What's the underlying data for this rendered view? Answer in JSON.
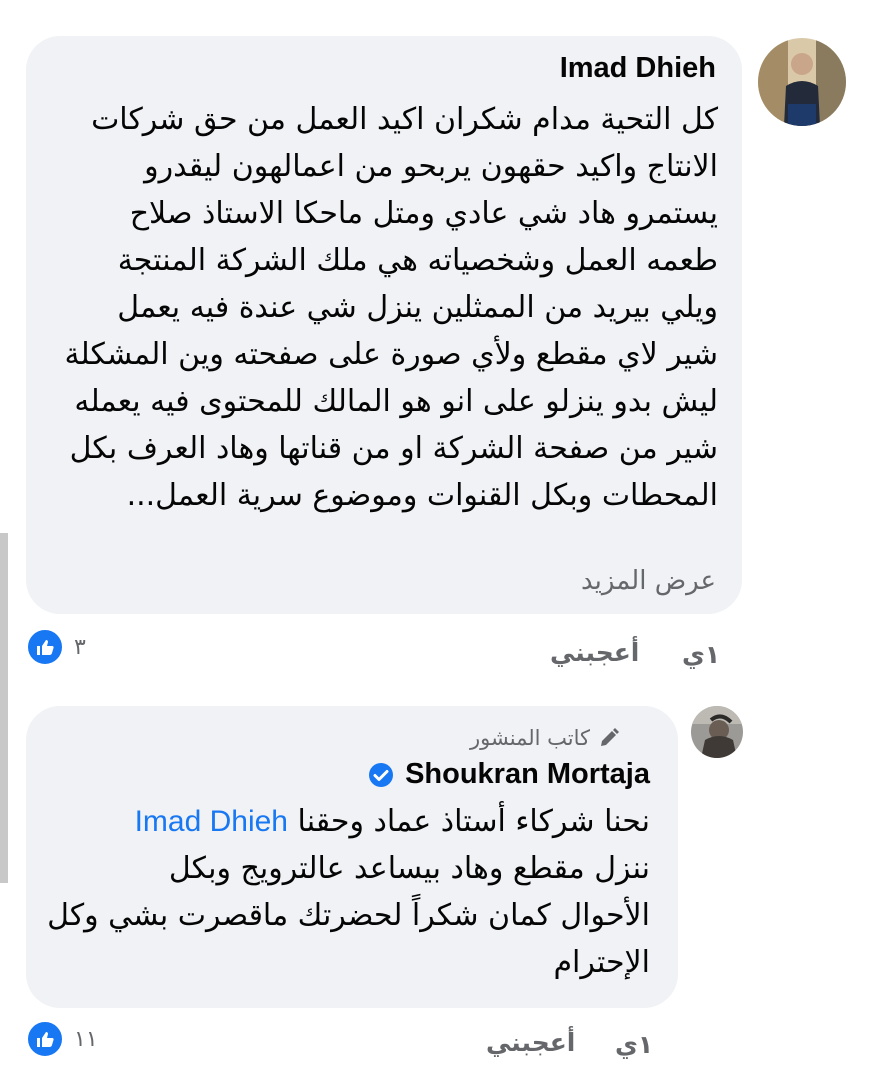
{
  "comments": [
    {
      "author": "Imad Dhieh",
      "lines": [
        "كل التحية مدام شكران اكيد العمل من حق شركات",
        "الانتاج واكيد حقهون يربحو من اعمالهون ليقدرو",
        "يستمرو هاد شي عادي ومتل ماحكا الاستاذ صلاح",
        "طعمه العمل وشخصياته هي ملك الشركة المنتجة",
        "ويلي بيريد من الممثلين ينزل شي عندة فيه يعمل",
        "شير لاي مقطع ولأي صورة على صفحته وين المشكلة",
        "ليش بدو ينزلو على انو هو المالك للمحتوى فيه يعمله",
        "شير من صفحة الشركة او من قناتها وهاد العرف بكل",
        "المحطات وبكل القنوات وموضوع سرية العمل..."
      ],
      "see_more": "عرض المزيد",
      "time": "١ي",
      "like_label": "أعجبني",
      "reaction_count": "٣",
      "avatar_icon": "person-photo-icon"
    },
    {
      "author_badge": "كاتب المنشور",
      "author": "Shoukran Mortaja",
      "verified_icon": "verified-badge-icon",
      "mention": "Imad Dhieh",
      "first_line_text": "نحنا شركاء أستاذ عماد وحقنا",
      "lines": [
        "ننزل مقطع وهاد بيساعد عالترويج وبكل",
        "الأحوال كمان شكراً لحضرتك ماقصرت بشي وكل",
        "الإحترام"
      ],
      "time": "١ي",
      "like_label": "أعجبني",
      "reaction_count": "١١",
      "avatar_icon": "person-photo-icon"
    }
  ],
  "colors": {
    "bubble": "#f0f2f5",
    "link": "#1877f2",
    "secondary": "#65676b",
    "like": "#1877f2"
  }
}
